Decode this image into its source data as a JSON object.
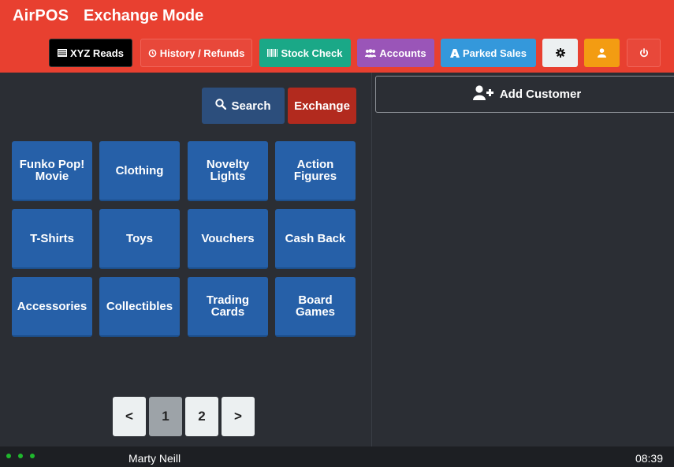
{
  "header": {
    "brand": "AirPOS",
    "mode": "Exchange Mode"
  },
  "toolbar": {
    "xyz_reads": "XYZ Reads",
    "history_refunds": "History / Refunds",
    "stock_check": "Stock Check",
    "accounts": "Accounts",
    "parked_sales": "Parked Sales"
  },
  "actions": {
    "search": "Search",
    "exchange": "Exchange"
  },
  "categories": [
    "Funko Pop! Movie",
    "Clothing",
    "Novelty Lights",
    "Action Figures",
    "T-Shirts",
    "Toys",
    "Vouchers",
    "Cash Back",
    "Accessories",
    "Collectibles",
    "Trading Cards",
    "Board Games"
  ],
  "pagination": {
    "prev": "<",
    "pages": [
      "1",
      "2"
    ],
    "current": "1",
    "next": ">"
  },
  "customer": {
    "add_label": "Add Customer"
  },
  "footer": {
    "user": "Marty Neill",
    "time": "08:39"
  },
  "colors": {
    "header_bg": "#e84030",
    "tile_bg": "#2660a8",
    "panel_bg": "#2b2e34",
    "online_indicator": "#1fb82d"
  },
  "icons": {
    "xyz_reads": "list-icon",
    "history_refunds": "history-icon",
    "stock_check": "barcode-icon",
    "accounts": "users-icon",
    "parked_sales": "parking-icon",
    "settings": "gear-icon",
    "profile": "user-icon",
    "logout": "power-icon",
    "search": "search-icon",
    "add_customer": "user-plus-icon"
  }
}
